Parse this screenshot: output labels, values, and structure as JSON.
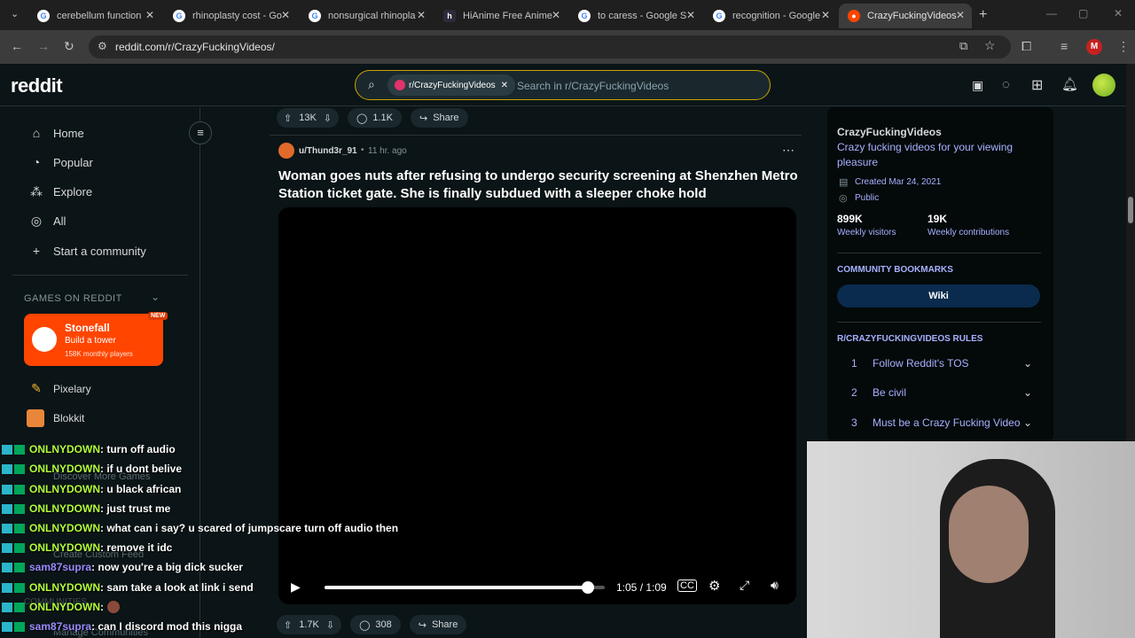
{
  "browser": {
    "tabs": [
      {
        "title": "cerebellum function",
        "icon": "google-icon"
      },
      {
        "title": "rhinoplasty cost - Go",
        "icon": "google-icon"
      },
      {
        "title": "nonsurgical rhinopla",
        "icon": "google-icon"
      },
      {
        "title": "HiAnime Free Anime",
        "icon": "hianime-icon"
      },
      {
        "title": "to caress - Google S",
        "icon": "google-icon"
      },
      {
        "title": "recognition - Google",
        "icon": "google-icon"
      },
      {
        "title": "CrazyFuckingVideos",
        "icon": "reddit-icon",
        "active": true
      }
    ],
    "url": "reddit.com/r/CrazyFuckingVideos/",
    "profile_initial": "M"
  },
  "reddit": {
    "logo": "reddit",
    "search_chip": "r/CrazyFuckingVideos",
    "search_placeholder": "Search in r/CrazyFuckingVideos",
    "sidebar": {
      "items": [
        {
          "label": "Home",
          "icon": "home-icon"
        },
        {
          "label": "Popular",
          "icon": "popular-icon"
        },
        {
          "label": "Explore",
          "icon": "explore-icon"
        },
        {
          "label": "All",
          "icon": "all-icon"
        },
        {
          "label": "Start a community",
          "icon": "plus-icon"
        }
      ],
      "games_heading": "GAMES ON REDDIT",
      "featured_game": {
        "name": "Stonefall",
        "tagline": "Build a tower",
        "players": "158K monthly players",
        "badge": "NEW"
      },
      "games": [
        {
          "name": "Pixelary",
          "icon": "pencil-icon"
        },
        {
          "name": "Blokkit",
          "icon": "blocks-icon"
        }
      ],
      "faded_items": [
        "Discover More Games",
        "Create Custom Feed",
        "COMMUNITIES",
        "Manage Communities"
      ]
    },
    "prev_post_actions": {
      "votes": "13K",
      "comments": "1.1K",
      "share": "Share"
    },
    "post": {
      "author": "u/Thund3r_91",
      "time": "11 hr. ago",
      "title_line1": "Woman goes nuts after refusing to undergo security screening at Shenzhen Metro",
      "title_line2": "Station ticket gate. She is finally subdued with a sleeper choke hold",
      "video_time": "1:05 / 1:09",
      "video_progress": 0.94,
      "votes": "1.7K",
      "comments": "308",
      "share": "Share"
    },
    "community": {
      "name": "CrazyFuckingVideos",
      "description": "Crazy fucking videos for your viewing pleasure",
      "created": "Created Mar 24, 2021",
      "visibility": "Public",
      "visitors": "899K",
      "visitors_label": "Weekly visitors",
      "contributions": "19K",
      "contributions_label": "Weekly contributions",
      "bookmarks_heading": "COMMUNITY BOOKMARKS",
      "wiki": "Wiki",
      "rules_heading": "R/CRAZYFUCKINGVIDEOS RULES",
      "rules": [
        {
          "num": "1",
          "text": "Follow Reddit's TOS"
        },
        {
          "num": "2",
          "text": "Be civil"
        },
        {
          "num": "3",
          "text": "Must be a Crazy Fucking Video"
        }
      ]
    }
  },
  "chat_overlay": [
    {
      "user": "ONLNYDOWN",
      "msg": ": turn off audio"
    },
    {
      "user": "ONLNYDOWN",
      "msg": ": if u dont belive"
    },
    {
      "user": "ONLNYDOWN",
      "msg": ": u black african"
    },
    {
      "user": "ONLNYDOWN",
      "msg": ": just trust me"
    },
    {
      "user": "ONLNYDOWN",
      "msg": ": what can i say? u scared of jumpscare turn off audio then"
    },
    {
      "user": "ONLNYDOWN",
      "msg": ": remove it idc"
    },
    {
      "user": "sam87supra",
      "msg": ": now you're a big dick sucker"
    },
    {
      "user": "ONLNYDOWN",
      "msg": ": sam take a look at link i send"
    },
    {
      "user": "ONLNYDOWN",
      "msg": ": "
    },
    {
      "user": "sam87supra",
      "msg": ": can I discord mod this nigga"
    }
  ],
  "colors": {
    "accent": "#648efc",
    "search_border": "#c9a300",
    "game_card": "#ff4500",
    "bookmark_btn": "#0a2b4d"
  }
}
